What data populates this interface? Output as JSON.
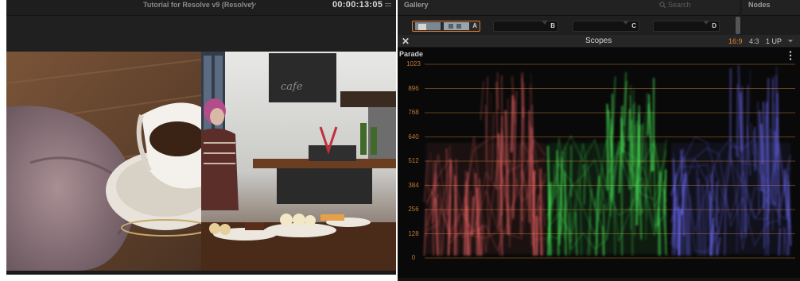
{
  "viewer": {
    "clip_title": "Tutorial for Resolve v9 (Resolve)",
    "timecode": "00:00:13:05",
    "image_description_icon": "cafe-scene-split-view"
  },
  "gallery": {
    "title": "Gallery",
    "search_placeholder": "Search",
    "slots": [
      {
        "label": "A"
      },
      {
        "label": "B"
      },
      {
        "label": "C"
      },
      {
        "label": "D"
      }
    ]
  },
  "nodes": {
    "title": "Nodes"
  },
  "scopes": {
    "close_label": "✕",
    "title": "Scopes",
    "aspect_options": [
      "16:9",
      "4:3"
    ],
    "aspect_selected": "16:9",
    "layout_value": "1 UP",
    "scope_type": "Parade",
    "scale_labels": [
      "1023",
      "896",
      "768",
      "640",
      "512",
      "384",
      "256",
      "128",
      "0"
    ]
  },
  "colors": {
    "accent_orange": "#d97a30",
    "scale_text": "#c07a2c",
    "trace_red": "#ff6a6a",
    "trace_green": "#4dff5e",
    "trace_blue": "#6f6dff",
    "panel_bg": "#1b1b1b"
  }
}
